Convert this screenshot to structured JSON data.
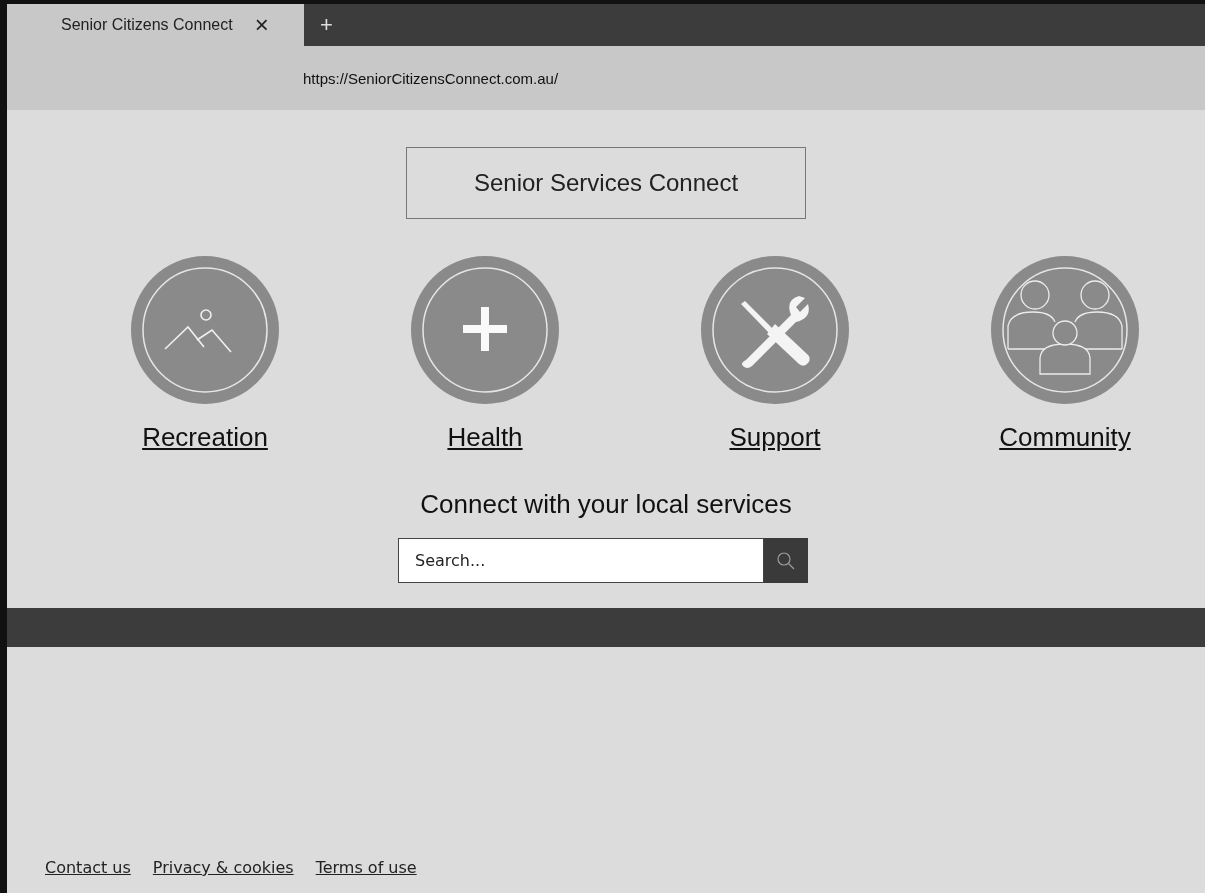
{
  "browser": {
    "tab_title": "Senior Citizens Connect",
    "close_glyph": "×",
    "new_tab_glyph": "+",
    "address": "https://SeniorCitizensConnect.com.au/"
  },
  "site_title": "Senior Services Connect",
  "categories": [
    {
      "label": "Recreation",
      "kind": "mountains"
    },
    {
      "label": "Health",
      "kind": "plus"
    },
    {
      "label": "Support",
      "kind": "tools"
    },
    {
      "label": "Community",
      "kind": "people"
    }
  ],
  "heading": "Connect with your local services",
  "search": {
    "placeholder": "Search..."
  },
  "footer_links": [
    "Contact us",
    "Privacy & cookies",
    "Terms of use"
  ]
}
